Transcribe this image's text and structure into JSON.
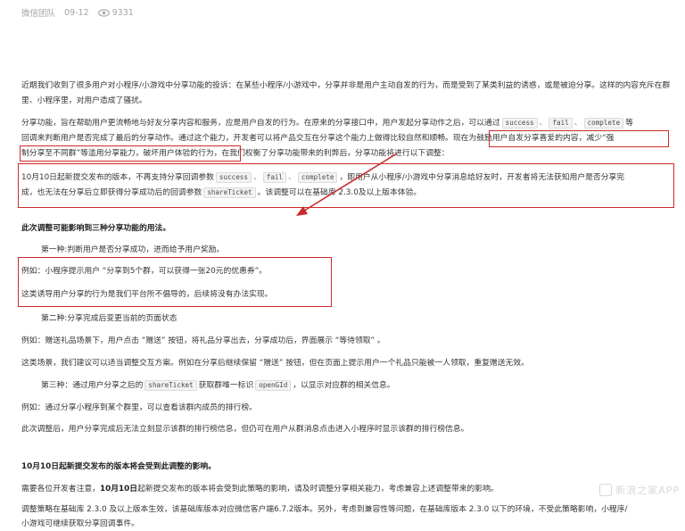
{
  "meta": {
    "author": "微信团队",
    "date": "09-12",
    "views": "9331"
  },
  "p1": "近期我们收到了很多用户对小程序/小游戏中分享功能的投诉：在某些小程序/小游戏中，分享并非是用户主动自发的行为，而是受到了某类利益的诱惑，或是被迫分享。这样的内容充斥在群里、小程序里，对用户造成了骚扰。",
  "p2": {
    "a": "分享功能，旨在帮助用户更流畅地与好友分享内容和服务，应是用户自发的行为。在原来的分享接口中，用户发起分享动作之后，可以通过",
    "c1": "success",
    "s1": "、",
    "c2": "fail",
    "s2": "、",
    "c3": "complete",
    "b": "等",
    "line2a": "回调来判断用户是否完成了最后的分享动作。通过这个能力，开发者可以将产品交互在分享这个能力上做得比较自然和顺畅。",
    "line2b": "现在为鼓励用户自发分享喜爱的内容，减少“强",
    "line3a": "制分享至不同群”等滥用分享能力，破坏用户体验的行为，",
    "line3b": "在我们权衡了分享功能带来的利弊后，分享功能将进行以下调整："
  },
  "p3": {
    "a": "10月10日起新提交发布的版本，不再支持分享回调参数",
    "c1": "success",
    "s1": "、",
    "c2": "fail",
    "s2": "、",
    "c3": "complete",
    "b": "，即用户从小程序/小游戏中分享消息给好友时，开发者将无法获知用户是否分享完",
    "line2a": "成，也无法在分享后立即获得分享成功后的回调参数",
    "c4": "shareTicket",
    "line2b": "。该调整可以在基础库 2.3.0及以上版本体验。"
  },
  "h1": "此次调整可能影响到三种分享功能的用法。",
  "first": "第一种:判断用户是否分享成功，进而给予用户奖励。",
  "ex1": "例如：小程序提示用户 “分享到5个群，可以获得一张20元的优惠券”。",
  "ex1b": "这类诱导用户分享的行为是我们平台所不倡导的，后续将没有办法实现。",
  "second": "第二种:分享完成后变更当前的页面状态",
  "ex2": "例如：赠送礼品场景下，用户点击 “赠送” 按钮，将礼品分享出去，分享成功后，界面展示 “等待领取” 。",
  "ex2b": "这类场景，我们建议可以适当调整交互方案。例如在分享后继续保留 “赠送” 按钮，但在页面上提示用户一个礼品只能被一人领取，重复赠送无效。",
  "third": {
    "a": "第三种：通过用户分享之后的",
    "c1": "shareTicket",
    "b": "获取群唯一标识",
    "c2": "openGId",
    "c": "，以显示对应群的相关信息。"
  },
  "ex3": "例如：通过分享小程序到某个群里，可以查看该群内成员的排行榜。",
  "ex3b": "此次调整后，用户分享完成后无法立刻显示该群的排行榜信息，但仍可在用户从群消息点击进入小程序时显示该群的排行榜信息。",
  "h2": "10月10日起新提交发布的版本将会受到此调整的影响。",
  "p4": {
    "a": "需要各位开发者注意，",
    "b": "10月10日",
    "c": "起新提交发布的版本将会受到此策略的影响，请及时调整分享相关能力，考虑兼容上述调整带来的影响。"
  },
  "p5": {
    "line1": "调整策略在基础库 2.3.0 及以上版本生效，该基础库版本对应微信客户端6.7.2版本。另外，考虑到兼容性等问题，在基础库版本 2.3.0 以下的环境，不受此策略影响，小程序/",
    "line2": "小游戏可继续获取分享回调事件。"
  },
  "watermark": "新浪之家APP",
  "colors": {
    "annotation": "#cc2a2a",
    "meta": "#a3a3a3"
  }
}
